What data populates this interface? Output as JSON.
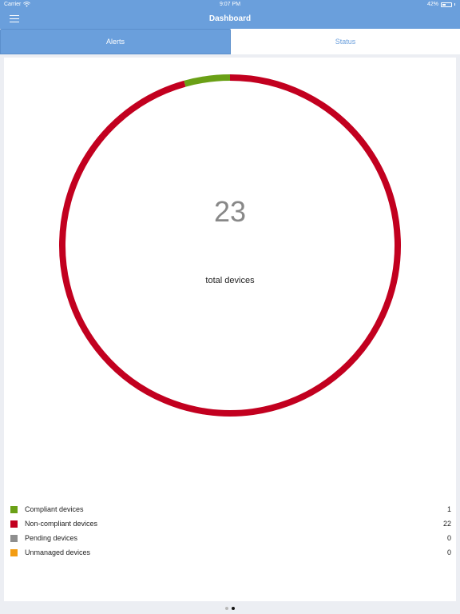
{
  "status_bar": {
    "carrier": "Carrier",
    "time": "9:07 PM",
    "battery": "42%",
    "battery_level": 0.42,
    "icons": {
      "wifi": "wifi-icon",
      "battery": "battery-icon"
    }
  },
  "nav": {
    "title": "Dashboard",
    "menu_icon": "hamburger-menu-icon"
  },
  "tabs": [
    {
      "label": "Alerts",
      "active": true
    },
    {
      "label": "Status",
      "active": false
    }
  ],
  "chart_data": {
    "type": "pie",
    "categories": [
      "Compliant devices",
      "Non-compliant devices",
      "Pending devices",
      "Unmanaged devices"
    ],
    "values": [
      1,
      22,
      0,
      0
    ],
    "colors": [
      "#6aa016",
      "#c2001f",
      "#8e8e8e",
      "#f39c12"
    ],
    "center_value": "23",
    "center_label": "total devices",
    "legend": "bottom"
  },
  "legend": [
    {
      "label": "Compliant devices",
      "count": "1",
      "color": "#6aa016"
    },
    {
      "label": "Non-compliant devices",
      "count": "22",
      "color": "#c2001f"
    },
    {
      "label": "Pending devices",
      "count": "0",
      "color": "#8e8e8e"
    },
    {
      "label": "Unmanaged devices",
      "count": "0",
      "color": "#f39c12"
    }
  ],
  "pager": {
    "count": 2,
    "active_index": 1
  }
}
